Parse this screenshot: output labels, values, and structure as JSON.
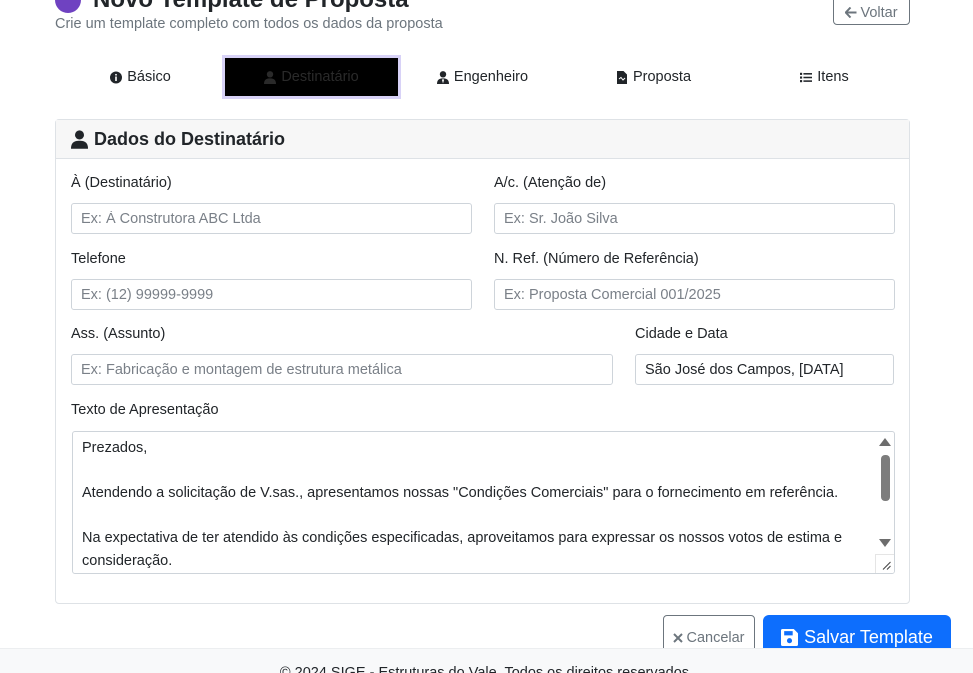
{
  "header": {
    "title": "Novo Template de Proposta",
    "subtitle": "Crie um template completo com todos os dados da proposta",
    "back_label": "Voltar"
  },
  "tabs": [
    {
      "label": "Básico",
      "icon": "info-circle-icon"
    },
    {
      "label": "Destinatário",
      "icon": "user-icon",
      "active": true
    },
    {
      "label": "Engenheiro",
      "icon": "user-tie-icon"
    },
    {
      "label": "Proposta",
      "icon": "file-icon"
    },
    {
      "label": "Itens",
      "icon": "list-icon"
    }
  ],
  "card": {
    "title": "Dados do Destinatário",
    "icon": "user-icon"
  },
  "fields": {
    "destinatario": {
      "label": "À (Destinatário)",
      "placeholder": "Ex: À Construtora ABC Ltda",
      "value": ""
    },
    "atencao": {
      "label": "A/c. (Atenção de)",
      "placeholder": "Ex: Sr. João Silva",
      "value": ""
    },
    "telefone": {
      "label": "Telefone",
      "placeholder": "Ex: (12) 99999-9999",
      "value": ""
    },
    "referencia": {
      "label": "N. Ref. (Número de Referência)",
      "placeholder": "Ex: Proposta Comercial 001/2025",
      "value": ""
    },
    "assunto": {
      "label": "Ass. (Assunto)",
      "placeholder": "Ex: Fabricação e montagem de estrutura metálica",
      "value": ""
    },
    "cidade_data": {
      "label": "Cidade e Data",
      "placeholder": "",
      "value": "São José dos Campos, [DATA]"
    },
    "apresentacao": {
      "label": "Texto de Apresentação",
      "lines": [
        "Prezados,",
        "",
        "Atendendo a solicitação de V.sas., apresentamos nossas \"Condições Comerciais\" para o fornecimento em referência.",
        "",
        "Na expectativa de ter atendido às condições especificadas, aproveitamos para expressar os nossos votos de estima e consideração."
      ]
    }
  },
  "actions": {
    "cancel_label": "Cancelar",
    "save_label": "Salvar Template"
  },
  "footer": {
    "text": "© 2024 SIGE - Estruturas do Vale. Todos os direitos reservados."
  },
  "colors": {
    "primary": "#0d6efd",
    "secondary": "#6c757d",
    "header_icon": "#6f42c1"
  }
}
